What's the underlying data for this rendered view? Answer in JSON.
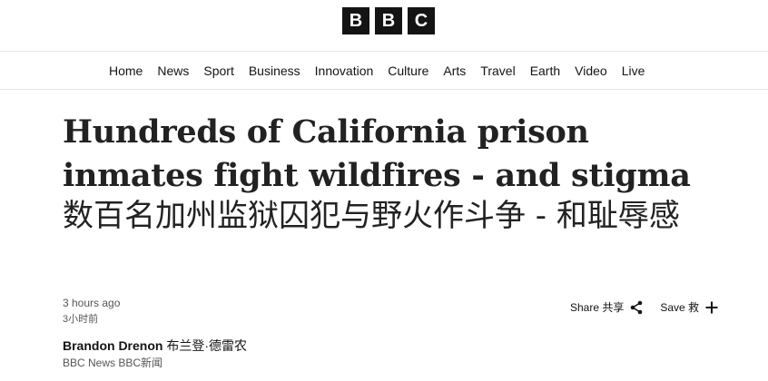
{
  "brand": {
    "letters": [
      "B",
      "B",
      "C"
    ]
  },
  "nav": {
    "items": [
      "Home",
      "News",
      "Sport",
      "Business",
      "Innovation",
      "Culture",
      "Arts",
      "Travel",
      "Earth",
      "Video",
      "Live"
    ]
  },
  "article": {
    "headline": "Hundreds of California prison inmates fight wildfires - and stigma",
    "headline_zh": "数百名加州监狱囚犯与野火作斗争 - 和耻辱感",
    "time": "3 hours ago",
    "time_zh": "3小时前",
    "author_name": "Brandon Drenon",
    "author_name_zh": "布兰登·德雷农",
    "author_org": "BBC News",
    "author_org_zh": "BBC新闻"
  },
  "actions": {
    "share_label": "Share 共享",
    "save_label": "Save 救",
    "share_icon": "share-icon",
    "save_icon": "plus-icon"
  }
}
